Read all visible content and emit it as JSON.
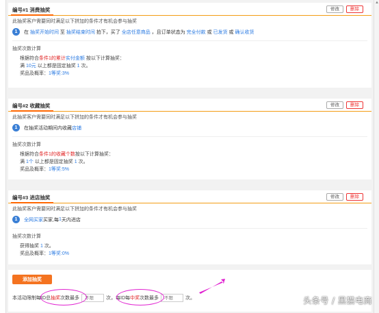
{
  "lotteries": [
    {
      "title": "编号#1 消费抽奖",
      "edit_label": "修改",
      "delete_label": "删除",
      "cond_intro": "此抽奖客户需要同时满足以下拼加的条件才有机会参与抽奖",
      "cond": {
        "p1": "在",
        "l1": "抽奖开始时间",
        "p2": "至",
        "l2": "抽奖结束时间",
        "p3": "拍下，买了",
        "l3": "全店任意商品",
        "p4": "，且订单状态为",
        "l4": "完全付款",
        "p5": "或",
        "l5": "已发货",
        "p6": "或",
        "l6": "确认收货"
      },
      "calc_head": "抽奖次数计算",
      "rule": {
        "a": "根据符合",
        "b": "条件1的累计",
        "c": "实付金额",
        "d": "按以下计算抽奖："
      },
      "full": {
        "a": "满",
        "b": "10元",
        "c": "以上都是固定抽奖",
        "d": "1",
        "e": "次。"
      },
      "prize": {
        "a": "奖品及概率：",
        "b": "1等奖:3%"
      }
    },
    {
      "title": "编号#2 收藏抽奖",
      "edit_label": "修改",
      "delete_label": "删除",
      "cond_intro": "此抽奖客户需要同时满足以下拼加的条件才有机会参与抽奖",
      "cond": {
        "a": "在抽奖活动期间内收藏",
        "b": "店铺"
      },
      "calc_head": "抽奖次数计算",
      "rule": {
        "a": "根据符合",
        "b": "条件1的收藏个数",
        "c": "按以下计算抽奖："
      },
      "full": {
        "a": "满",
        "b": "1个",
        "c": "以上都是固定抽奖",
        "d": "1",
        "e": "次。"
      },
      "prize": {
        "a": "奖品及概率：",
        "b": "1等奖:5%"
      }
    },
    {
      "title": "编号#3 进店抽奖",
      "edit_label": "修改",
      "delete_label": "删除",
      "cond_intro": "此抽奖客户需要同时满足以下拼加的条件才有机会参与抽奖",
      "cond": {
        "a": "全网买家",
        "b": "买家,每",
        "c": "1",
        "d": "天内进店"
      },
      "calc_head": "抽奖次数计算",
      "gain": {
        "a": "获得抽奖",
        "b": "1",
        "c": "次。"
      },
      "prize": {
        "a": "奖品及概率：",
        "b": "1等奖:0%"
      }
    }
  ],
  "add_button": "添加抽奖",
  "limit": {
    "a": "本活动限制每ID",
    "b": "总",
    "c": "抽奖",
    "d": "次数最多",
    "input1_placeholder": "不限",
    "e": "次，",
    "f": "每ID",
    "g": "每",
    "h": "中奖",
    "i": "次数最多",
    "input2_placeholder": "不限",
    "j": "次。"
  },
  "watermark": "头条号 / 黑猫电商",
  "colors": {
    "accent": "#f47320",
    "link": "#2a7ae2",
    "danger": "#e02020",
    "annotation": "#e020d0"
  }
}
